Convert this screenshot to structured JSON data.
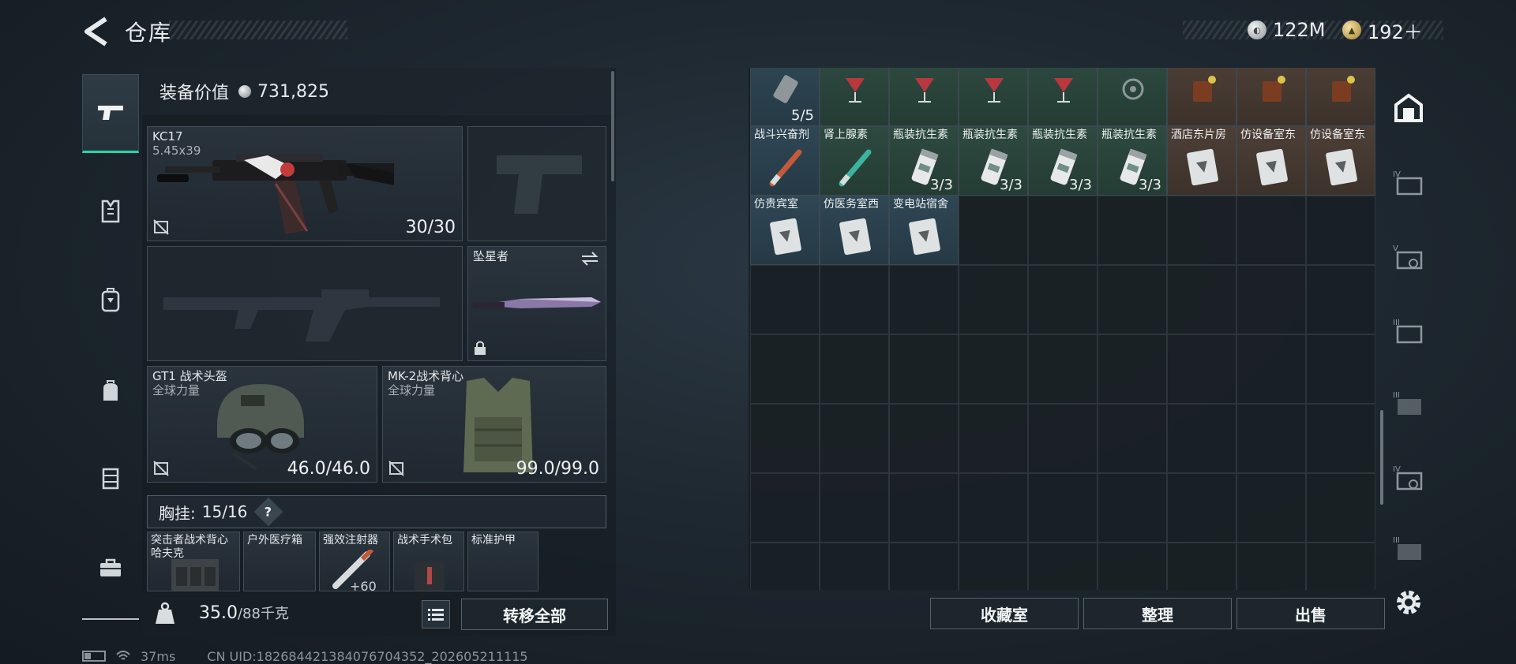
{
  "header": {
    "title": "仓库",
    "currencies": [
      {
        "icon": "silver-coin-icon",
        "amount": "122M"
      },
      {
        "icon": "gold-coin-icon",
        "amount": "192＋"
      }
    ]
  },
  "left_rail": [
    "pistol-icon",
    "armor-vest-icon",
    "backpack-icon",
    "bag-icon",
    "chest-rig-icon",
    "toolbox-icon"
  ],
  "equipment": {
    "value_label": "装备价值",
    "value": "731,825",
    "primary_weapon": {
      "name": "KC17",
      "caliber": "5.45x39",
      "ammo": "30/30"
    },
    "secondary_weapon": {
      "name": "",
      "empty": true
    },
    "melee": {
      "name": "坠星者"
    },
    "helmet": {
      "name": "GT1 战术头盔",
      "brand": "全球力量",
      "durability": "46.0/46.0"
    },
    "armor": {
      "name": "MK-2战术背心",
      "brand": "全球力量",
      "durability": "99.0/99.0"
    },
    "chest_label": "胸挂:",
    "chest_count": "15/16",
    "chest_help": "?",
    "chest_items": [
      {
        "name": "突击者战术背心",
        "sub": "哈夫克"
      },
      {
        "name": "户外医疗箱",
        "sub": ""
      },
      {
        "name": "强效注射器",
        "sub": "",
        "count": "+60"
      },
      {
        "name": "战术手术包",
        "sub": ""
      },
      {
        "name": "标准护甲",
        "sub": ""
      }
    ]
  },
  "bottom": {
    "weight": "35.0",
    "weight_max": "/88千克",
    "transfer_all": "转移全部",
    "vault": "收藏室",
    "sort": "整理",
    "sell": "出售"
  },
  "inventory": {
    "top_row_count": "5/5",
    "items": [
      {
        "name": "战斗兴奋剂",
        "color": "blue",
        "count": ""
      },
      {
        "name": "肾上腺素",
        "color": "green",
        "count": ""
      },
      {
        "name": "瓶装抗生素",
        "color": "green",
        "count": "3/3"
      },
      {
        "name": "瓶装抗生素",
        "color": "green",
        "count": "3/3"
      },
      {
        "name": "瓶装抗生素",
        "color": "green",
        "count": "3/3"
      },
      {
        "name": "瓶装抗生素",
        "color": "green",
        "count": "3/3"
      },
      {
        "name": "酒店东片房",
        "color": "orange",
        "count": ""
      },
      {
        "name": "仿设备室东",
        "color": "orange",
        "count": ""
      },
      {
        "name": "仿设备室东",
        "color": "orange",
        "count": ""
      },
      {
        "name": "仿贵宾室",
        "color": "blue",
        "count": ""
      },
      {
        "name": "仿医务室西",
        "color": "blue",
        "count": ""
      },
      {
        "name": "变电站宿舍",
        "color": "blue",
        "count": ""
      }
    ]
  },
  "right_rail": [
    "safehouse-icon",
    "container-iv-icon",
    "container-v-icon",
    "container-iii-icon",
    "container-iii-b-icon",
    "container-iv-b-icon",
    "container-iii-c-icon"
  ],
  "status_bar": {
    "ping": "37ms",
    "uid": "CN UID:182684421384076704352_202605211115"
  },
  "colors": {
    "accent": "#24d6a8",
    "panel": "#1b2126",
    "text": "#eef1f2"
  }
}
